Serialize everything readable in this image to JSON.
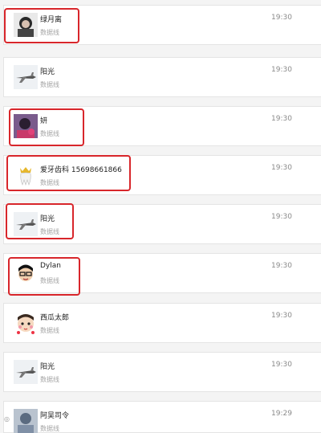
{
  "conversations": [
    {
      "name": "绿月离",
      "subtitle": "数据线",
      "time": "19:30",
      "avatar_icon": "person-photo-icon"
    },
    {
      "name": "阳光",
      "subtitle": "数据线",
      "time": "19:30",
      "avatar_icon": "airplane-icon"
    },
    {
      "name": "妍",
      "subtitle": "数据线",
      "time": "19:30",
      "avatar_icon": "person-photo-icon"
    },
    {
      "name": "爱牙齿科 15698661866",
      "subtitle": "数据线",
      "time": "19:30",
      "avatar_icon": "tooth-crown-icon"
    },
    {
      "name": "阳光",
      "subtitle": "数据线",
      "time": "19:30",
      "avatar_icon": "airplane-icon"
    },
    {
      "name": "Dylan",
      "subtitle": "数据线",
      "time": "19:30",
      "avatar_icon": "cartoon-face-icon"
    },
    {
      "name": "西瓜太郎",
      "subtitle": "数据线",
      "time": "19:30",
      "avatar_icon": "cartoon-face-icon"
    },
    {
      "name": "阳光",
      "subtitle": "数据线",
      "time": "19:30",
      "avatar_icon": "airplane-icon"
    },
    {
      "name": "阿吴司令",
      "subtitle": "数据线",
      "time": "19:29",
      "avatar_icon": "person-photo-icon"
    }
  ],
  "highlight_color": "#d8262b"
}
